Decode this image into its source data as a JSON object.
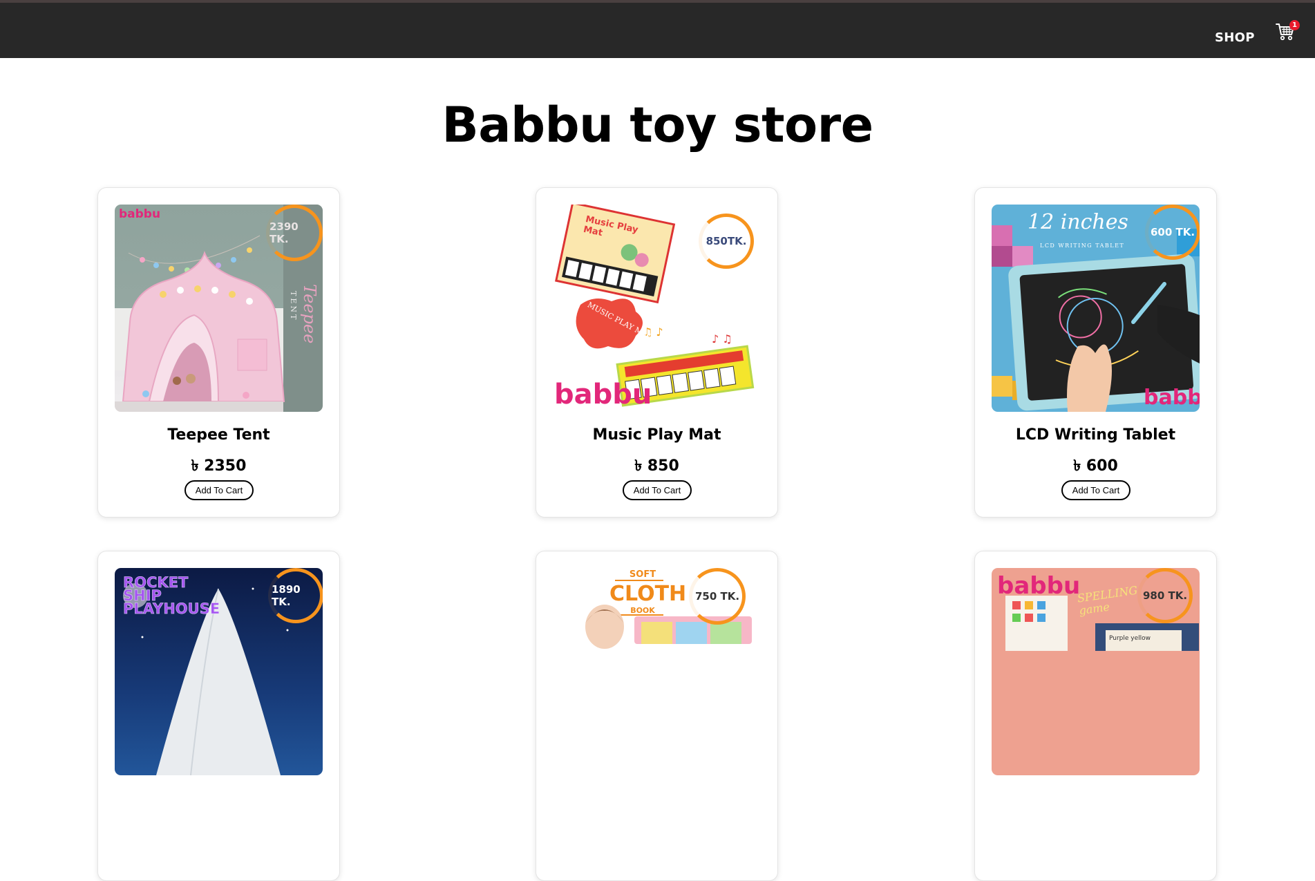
{
  "nav": {
    "shop_label": "SHOP",
    "cart_count": "1"
  },
  "page": {
    "title": "Babbu toy store"
  },
  "products": [
    {
      "name": "Teepee Tent",
      "price": "৳ 2350",
      "badge_price": "2390 TK.",
      "img_text_1": "Teepee",
      "img_text_2": "TENT",
      "logo": "babbu",
      "button": "Add To Cart"
    },
    {
      "name": "Music Play Mat",
      "price": "৳ 850",
      "badge_price": "850TK.",
      "img_text_1": "Music Play Mat",
      "img_text_2": "MUSIC PLAY MAT",
      "logo": "babbu",
      "button": "Add To Cart"
    },
    {
      "name": "LCD Writing Tablet",
      "price": "৳ 600",
      "badge_price": "600 TK.",
      "img_text_1": "12 inches",
      "img_text_2": "LCD WRITING TABLET",
      "logo": "babbu",
      "button": "Add To Cart"
    },
    {
      "badge_price": "1890 TK.",
      "img_text_1": "ROCKET SHIP PLAYHOUSE"
    },
    {
      "badge_price": "750 TK.",
      "img_text_1": "SOFT",
      "img_text_2": "CLOTH",
      "img_text_3": "BOOK"
    },
    {
      "badge_price": "980 TK.",
      "img_text_1": "SPELLING game",
      "img_text_2": "Purple   yellow",
      "logo": "babbu"
    }
  ]
}
